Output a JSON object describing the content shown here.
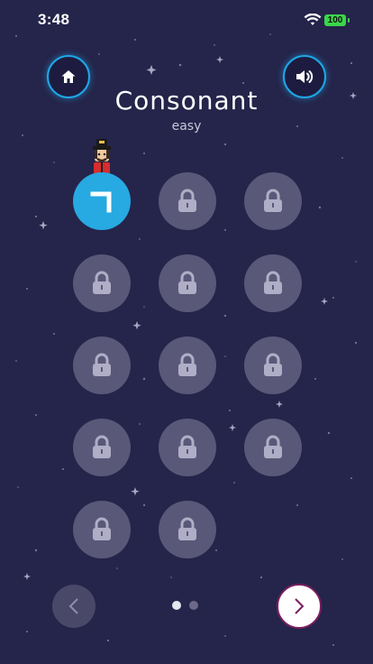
{
  "status_bar": {
    "time": "3:48",
    "battery": "100"
  },
  "header": {
    "title": "Consonant",
    "subtitle": "easy",
    "home_icon": "home-icon",
    "sound_icon": "speaker-icon"
  },
  "levels": [
    {
      "state": "active",
      "glyph": "ㄱ"
    },
    {
      "state": "locked"
    },
    {
      "state": "locked"
    },
    {
      "state": "locked"
    },
    {
      "state": "locked"
    },
    {
      "state": "locked"
    },
    {
      "state": "locked"
    },
    {
      "state": "locked"
    },
    {
      "state": "locked"
    },
    {
      "state": "locked"
    },
    {
      "state": "locked"
    },
    {
      "state": "locked"
    },
    {
      "state": "locked"
    },
    {
      "state": "locked"
    }
  ],
  "pagination": {
    "current_page": 1,
    "page_count": 2,
    "prev_icon": "chevron-left-icon",
    "next_icon": "chevron-right-icon"
  },
  "colors": {
    "background": "#25244a",
    "accent": "#27a9e2",
    "locked": "#5a5878",
    "next_border": "#7a1f5e"
  }
}
